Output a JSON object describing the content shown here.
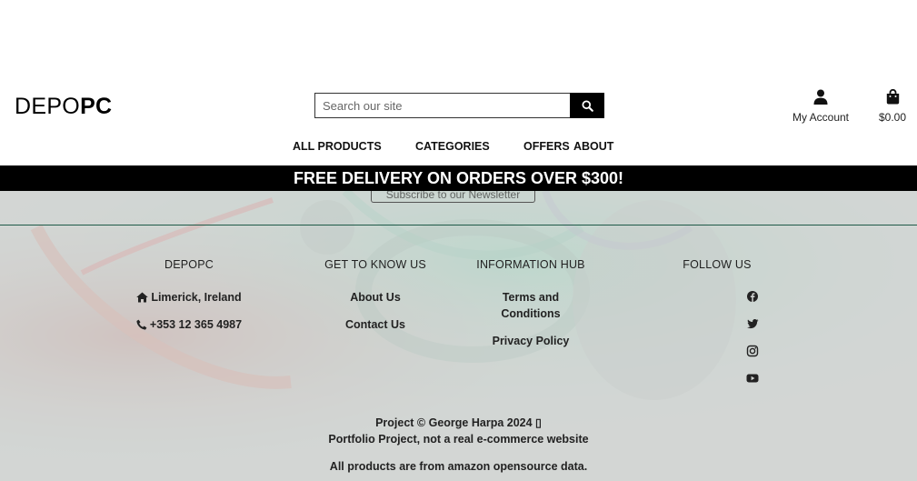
{
  "header": {
    "logo_regular": "DEPO",
    "logo_bold": "PC",
    "search": {
      "placeholder": "Search our site",
      "button_icon": "search-icon"
    },
    "account": {
      "label": "My Account",
      "icon": "user-icon"
    },
    "cart": {
      "total": "$0.00",
      "icon": "shopping-bag-icon"
    }
  },
  "nav": {
    "items": [
      {
        "label": "ALL PRODUCTS"
      },
      {
        "label": "CATEGORIES"
      },
      {
        "label": "OFFERS"
      },
      {
        "label": "ABOUT"
      }
    ]
  },
  "banner": {
    "text": "FREE DELIVERY ON ORDERS OVER $300!"
  },
  "newsletter": {
    "button_label": "Subscribe to our Newsletter"
  },
  "footer": {
    "columns": [
      {
        "heading": "DEPOPC",
        "items": [
          {
            "label": "Limerick, Ireland",
            "icon": "home-icon"
          },
          {
            "label": "+353 12 365 4987",
            "icon": "phone-icon"
          }
        ]
      },
      {
        "heading": "GET TO KNOW US",
        "items": [
          {
            "label": "About Us"
          },
          {
            "label": "Contact Us"
          }
        ]
      },
      {
        "heading": "INFORMATION HUB",
        "items": [
          {
            "label": "Terms and Conditions"
          },
          {
            "label": "Privacy Policy"
          }
        ]
      },
      {
        "heading": "FOLLOW US",
        "icons": [
          "facebook-icon",
          "twitter-icon",
          "instagram-icon",
          "youtube-icon"
        ]
      }
    ],
    "copyright_line1": "Project © George Harpa 2024 ▯",
    "copyright_line2": "Portfolio Project, not a real e-commerce website",
    "note": "All products are from amazon opensource data."
  },
  "colors": {
    "header_bg": "#ffffff",
    "banner_bg": "#000000",
    "banner_text": "#ffffff",
    "footer_bg": "#d2d5d3",
    "divider": "#1f5a48"
  }
}
